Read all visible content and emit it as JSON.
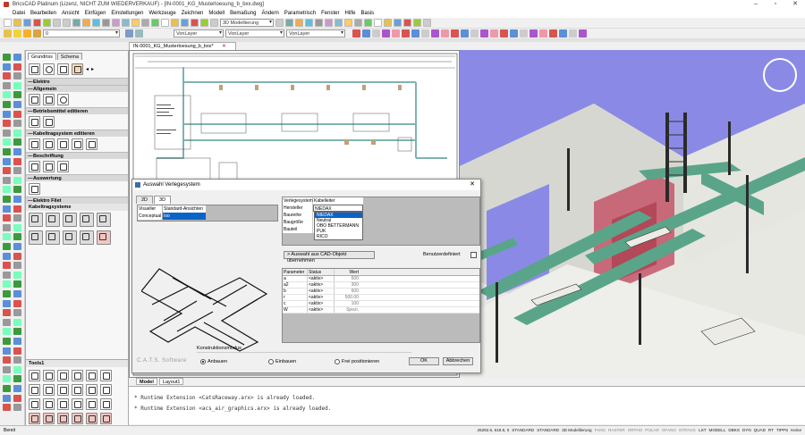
{
  "window": {
    "title": "BricsCAD Platinum (Lizenz, NICHT ZUM WIEDERVERKAUF) - [IN-0001_KG_Musterloesung_b_bxx.dwg]",
    "min": "–",
    "max": "▫",
    "close": "✕"
  },
  "menu": [
    "Datei",
    "Bearbeiten",
    "Ansicht",
    "Einfügen",
    "Einstellungen",
    "Werkzeuge",
    "Zeichnen",
    "Modell",
    "Bemaßung",
    "Ändern",
    "Parametrisch",
    "Fenster",
    "Hilfe",
    "Basis"
  ],
  "toolbar": {
    "workspace": "3D Modellierung",
    "layer": "0",
    "linetype_a": "VonLayer",
    "linetype_b": "VonLayer",
    "lineweight": "VonLayer"
  },
  "document_tab": "IN-0001_KG_Musterloesung_b_bxx*",
  "panel": {
    "tabs": [
      "Grundriss",
      "Schema"
    ],
    "group_title": "Elektro",
    "sections": [
      "Allgemein",
      "Betriebsmittel editieren",
      "Kabeltragsystem editieren",
      "Beschriftung",
      "Auswertung"
    ],
    "filet_title": "Elektro Filet",
    "kabeltrag_title": "Kabeltragsysteme",
    "tools_title": "Tools1"
  },
  "layout_tabs": [
    "Model",
    "Layout1"
  ],
  "command_line": [
    "* Runtime Extension <CatsRaceway.arx> is already loaded.",
    "* Runtime Extension <acs_air_graphics.arx> is already loaded."
  ],
  "status": {
    "left": "Bereit",
    "coords": "26292.6, 619.8, 0",
    "items": [
      "STANDARD",
      "STANDARD",
      "3D Modellierung",
      "FANG",
      "RASTER",
      "ORTHO",
      "POLAR",
      "OFANG",
      "OTRACK",
      "LST",
      "MODELL",
      "DBKS",
      "DYN",
      "QUAD",
      "RT",
      "TIPPS",
      "Keine"
    ]
  },
  "dialog": {
    "title": "Auswahl Verlegesystem",
    "tabs": [
      "2D",
      "3D"
    ],
    "visual": {
      "label1": "Visueller Stil",
      "value1": "Standard-Ansichten",
      "label2": "Conceptual",
      "value2": "Iso"
    },
    "right_table": {
      "labels": [
        "Verlegesystem",
        "Hersteller",
        "Baureihe",
        "Baugröße",
        "Bauteil"
      ],
      "verlegesystem_value": "Kabelleiter",
      "hersteller_value": "NIEDAX",
      "dropdown_options": [
        "NIEDAX",
        "Neutral",
        "OBO BETTERMANN",
        "PUK",
        "RICO"
      ],
      "selected_option": "NIEDAX"
    },
    "pick_button": "> Auswahl aus CAD-Objekt übernehmen",
    "user_defined": "Benutzerdefiniert",
    "param_headers": [
      "Parameter",
      "Status",
      "Wert"
    ],
    "params": [
      {
        "p": "a",
        "s": "<aktiv>",
        "w": "600"
      },
      {
        "p": "a2",
        "s": "<aktiv>",
        "w": "300"
      },
      {
        "p": "b",
        "s": "<aktiv>",
        "w": "600"
      },
      {
        "p": "r",
        "s": "<aktiv>",
        "w": "500.00"
      },
      {
        "p": "c",
        "s": "<aktiv>",
        "w": "100"
      },
      {
        "p": "W",
        "s": "<aktiv>",
        "w": "Spezi."
      }
    ],
    "watermark": "C.A.T.S. Software",
    "mode_label": "Konstruktionsmodus",
    "radios": [
      "Anbauen",
      "Einbauen",
      "Frei positionieren"
    ],
    "radio_selected": "Anbauen",
    "ok": "OK",
    "cancel": "Abbrechen"
  }
}
